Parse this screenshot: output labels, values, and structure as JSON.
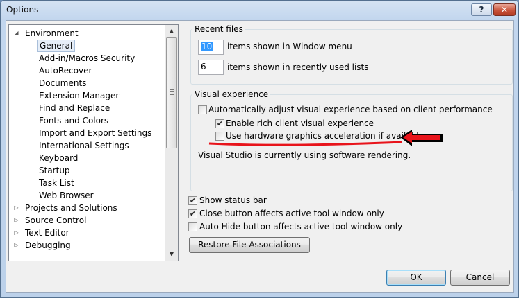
{
  "window": {
    "title": "Options",
    "help_glyph": "?",
    "close_glyph": "✕"
  },
  "tree": {
    "items": [
      {
        "label": "Environment",
        "expander": "◢",
        "indent": 0
      },
      {
        "label": "General",
        "indent": 1,
        "selected": true
      },
      {
        "label": "Add-in/Macros Security",
        "indent": 1
      },
      {
        "label": "AutoRecover",
        "indent": 1
      },
      {
        "label": "Documents",
        "indent": 1
      },
      {
        "label": "Extension Manager",
        "indent": 1
      },
      {
        "label": "Find and Replace",
        "indent": 1
      },
      {
        "label": "Fonts and Colors",
        "indent": 1
      },
      {
        "label": "Import and Export Settings",
        "indent": 1
      },
      {
        "label": "International Settings",
        "indent": 1
      },
      {
        "label": "Keyboard",
        "indent": 1
      },
      {
        "label": "Startup",
        "indent": 1
      },
      {
        "label": "Task List",
        "indent": 1
      },
      {
        "label": "Web Browser",
        "indent": 1
      },
      {
        "label": "Projects and Solutions",
        "expander": "▷",
        "indent": 0
      },
      {
        "label": "Source Control",
        "expander": "▷",
        "indent": 0
      },
      {
        "label": "Text Editor",
        "expander": "▷",
        "indent": 0
      },
      {
        "label": "Debugging",
        "expander": "▷",
        "indent": 0
      }
    ],
    "scroll_up": "▲",
    "scroll_down": "▼"
  },
  "recent_files": {
    "title": "Recent files",
    "window_menu_count": "10",
    "window_menu_label": "items shown in Window menu",
    "recent_lists_count": "6",
    "recent_lists_label": "items shown in recently used lists"
  },
  "visual_experience": {
    "title": "Visual experience",
    "auto_adjust": {
      "label": "Automatically adjust visual experience based on client performance",
      "checked": false
    },
    "rich_client": {
      "label": "Enable rich client visual experience",
      "checked": true
    },
    "hw_accel": {
      "label": "Use hardware graphics acceleration if available",
      "checked": false
    },
    "status_text": "Visual Studio is currently using software rendering."
  },
  "options": {
    "show_status_bar": {
      "label": "Show status bar",
      "checked": true
    },
    "close_button": {
      "label": "Close button affects active tool window only",
      "checked": true
    },
    "auto_hide": {
      "label": "Auto Hide button affects active tool window only",
      "checked": false
    }
  },
  "restore_label": "Restore File Associations",
  "ok_label": "OK",
  "cancel_label": "Cancel",
  "check_glyph": "✔",
  "annotation_color": "#e8141b"
}
